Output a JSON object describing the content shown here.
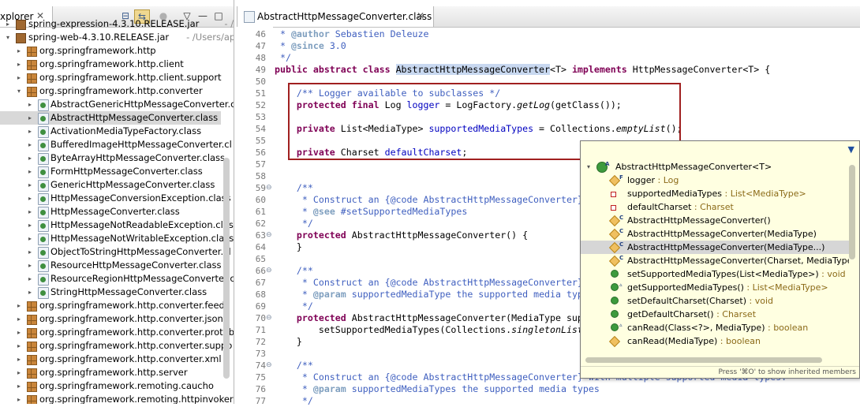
{
  "explorer": {
    "tab_label": "xplorer",
    "close_glyph": "✕",
    "toolbar": {
      "collapse_icon": "collapse-all-icon",
      "link_icon": "link-with-editor-icon",
      "view_menu_glyph": "▽",
      "minimize_glyph": "—",
      "maximize_glyph": "□"
    },
    "rows": [
      {
        "label": "spring-expression-4.3.10.RELEASE.jar",
        "suffix": " - /Users/",
        "type": "jar",
        "twisty": "▸",
        "indent": 0
      },
      {
        "label": "spring-web-4.3.10.RELEASE.jar",
        "suffix": " - /Users/appl",
        "type": "jar",
        "twisty": "▾",
        "indent": 0
      },
      {
        "label": "org.springframework.http",
        "suffix": "",
        "type": "pkg",
        "twisty": "▸",
        "indent": 1
      },
      {
        "label": "org.springframework.http.client",
        "suffix": "",
        "type": "pkg",
        "twisty": "▸",
        "indent": 1
      },
      {
        "label": "org.springframework.http.client.support",
        "suffix": "",
        "type": "pkg",
        "twisty": "▸",
        "indent": 1
      },
      {
        "label": "org.springframework.http.converter",
        "suffix": "",
        "type": "pkg",
        "twisty": "▾",
        "indent": 1
      },
      {
        "label": "AbstractGenericHttpMessageConverter.c",
        "suffix": "",
        "type": "cls",
        "twisty": "▸",
        "indent": 2
      },
      {
        "label": "AbstractHttpMessageConverter.class",
        "suffix": "",
        "type": "cls",
        "twisty": "▸",
        "indent": 2,
        "selected": true
      },
      {
        "label": "ActivationMediaTypeFactory.class",
        "suffix": "",
        "type": "cls",
        "twisty": "▸",
        "indent": 2
      },
      {
        "label": "BufferedImageHttpMessageConverter.cl",
        "suffix": "",
        "type": "cls",
        "twisty": "▸",
        "indent": 2
      },
      {
        "label": "ByteArrayHttpMessageConverter.class",
        "suffix": "",
        "type": "cls",
        "twisty": "▸",
        "indent": 2
      },
      {
        "label": "FormHttpMessageConverter.class",
        "suffix": "",
        "type": "cls",
        "twisty": "▸",
        "indent": 2
      },
      {
        "label": "GenericHttpMessageConverter.class",
        "suffix": "",
        "type": "cls",
        "twisty": "▸",
        "indent": 2
      },
      {
        "label": "HttpMessageConversionException.class",
        "suffix": "",
        "type": "cls",
        "twisty": "▸",
        "indent": 2
      },
      {
        "label": "HttpMessageConverter.class",
        "suffix": "",
        "type": "cls",
        "twisty": "▸",
        "indent": 2
      },
      {
        "label": "HttpMessageNotReadableException.clas",
        "suffix": "",
        "type": "cls",
        "twisty": "▸",
        "indent": 2
      },
      {
        "label": "HttpMessageNotWritableException.class",
        "suffix": "",
        "type": "cls",
        "twisty": "▸",
        "indent": 2
      },
      {
        "label": "ObjectToStringHttpMessageConverter.cl",
        "suffix": "",
        "type": "cls",
        "twisty": "▸",
        "indent": 2
      },
      {
        "label": "ResourceHttpMessageConverter.class",
        "suffix": "",
        "type": "cls",
        "twisty": "▸",
        "indent": 2
      },
      {
        "label": "ResourceRegionHttpMessageConverter.c",
        "suffix": "",
        "type": "cls",
        "twisty": "▸",
        "indent": 2
      },
      {
        "label": "StringHttpMessageConverter.class",
        "suffix": "",
        "type": "cls",
        "twisty": "▸",
        "indent": 2
      },
      {
        "label": "org.springframework.http.converter.feed",
        "suffix": "",
        "type": "pkg",
        "twisty": "▸",
        "indent": 1
      },
      {
        "label": "org.springframework.http.converter.json",
        "suffix": "",
        "type": "pkg",
        "twisty": "▸",
        "indent": 1
      },
      {
        "label": "org.springframework.http.converter.protob",
        "suffix": "",
        "type": "pkg",
        "twisty": "▸",
        "indent": 1
      },
      {
        "label": "org.springframework.http.converter.suppo",
        "suffix": "",
        "type": "pkg",
        "twisty": "▸",
        "indent": 1
      },
      {
        "label": "org.springframework.http.converter.xml",
        "suffix": "",
        "type": "pkg",
        "twisty": "▸",
        "indent": 1
      },
      {
        "label": "org.springframework.http.server",
        "suffix": "",
        "type": "pkg",
        "twisty": "▸",
        "indent": 1
      },
      {
        "label": "org.springframework.remoting.caucho",
        "suffix": "",
        "type": "pkg",
        "twisty": "▸",
        "indent": 1
      },
      {
        "label": "org.springframework.remoting.httpinvoker",
        "suffix": "",
        "type": "pkg",
        "twisty": "▸",
        "indent": 1
      }
    ]
  },
  "editor": {
    "tab_label": "AbstractHttpMessageConverter.class",
    "close_glyph": "✕",
    "lines": [
      {
        "n": "46",
        "fold": "",
        "parts": [
          {
            "t": " * ",
            "c": "cm"
          },
          {
            "t": "@author",
            "c": "tag"
          },
          {
            "t": " Sebastien Deleuze",
            "c": "cm"
          }
        ]
      },
      {
        "n": "47",
        "fold": "",
        "parts": [
          {
            "t": " * ",
            "c": "cm"
          },
          {
            "t": "@since",
            "c": "tag"
          },
          {
            "t": " 3.0",
            "c": "cm"
          }
        ]
      },
      {
        "n": "48",
        "fold": "",
        "parts": [
          {
            "t": " */",
            "c": "cm"
          }
        ]
      },
      {
        "n": "49",
        "fold": "",
        "parts": [
          {
            "t": "public abstract class ",
            "c": "kw"
          },
          {
            "t": "AbstractHttpMessageConverter",
            "c": "hl"
          },
          {
            "t": "<T> ",
            "c": ""
          },
          {
            "t": "implements ",
            "c": "kw"
          },
          {
            "t": "HttpMessageConverter<T> {",
            "c": ""
          }
        ]
      },
      {
        "n": "50",
        "fold": "",
        "parts": []
      },
      {
        "n": "51",
        "fold": "",
        "parts": [
          {
            "t": "    /** Logger available to subclasses */",
            "c": "cm"
          }
        ]
      },
      {
        "n": "52",
        "fold": "",
        "parts": [
          {
            "t": "    protected final ",
            "c": "kw"
          },
          {
            "t": "Log ",
            "c": ""
          },
          {
            "t": "logger",
            "c": "fd"
          },
          {
            "t": " = LogFactory.",
            "c": ""
          },
          {
            "t": "getLog",
            "c": "it"
          },
          {
            "t": "(getClass());",
            "c": ""
          }
        ]
      },
      {
        "n": "53",
        "fold": "",
        "parts": []
      },
      {
        "n": "54",
        "fold": "",
        "parts": [
          {
            "t": "    private ",
            "c": "kw"
          },
          {
            "t": "List<MediaType> ",
            "c": ""
          },
          {
            "t": "supportedMediaTypes",
            "c": "fd"
          },
          {
            "t": " = Collections.",
            "c": ""
          },
          {
            "t": "emptyList",
            "c": "it"
          },
          {
            "t": "();",
            "c": ""
          }
        ]
      },
      {
        "n": "55",
        "fold": "",
        "parts": []
      },
      {
        "n": "56",
        "fold": "",
        "parts": [
          {
            "t": "    private ",
            "c": "kw"
          },
          {
            "t": "Charset ",
            "c": ""
          },
          {
            "t": "defaultCharset",
            "c": "fd"
          },
          {
            "t": ";",
            "c": ""
          }
        ]
      },
      {
        "n": "57",
        "fold": "",
        "parts": []
      },
      {
        "n": "58",
        "fold": "",
        "parts": []
      },
      {
        "n": "59",
        "fold": "⊖",
        "parts": [
          {
            "t": "    /**",
            "c": "cm"
          }
        ]
      },
      {
        "n": "60",
        "fold": "",
        "parts": [
          {
            "t": "     * Construct an {@code AbstractHttpMessageConverter}",
            "c": "cm"
          }
        ]
      },
      {
        "n": "61",
        "fold": "",
        "parts": [
          {
            "t": "     * ",
            "c": "cm"
          },
          {
            "t": "@see",
            "c": "tag"
          },
          {
            "t": " #setSupportedMediaTypes",
            "c": "cm"
          }
        ]
      },
      {
        "n": "62",
        "fold": "",
        "parts": [
          {
            "t": "     */",
            "c": "cm"
          }
        ]
      },
      {
        "n": "63",
        "fold": "⊖",
        "parts": [
          {
            "t": "    protected ",
            "c": "kw"
          },
          {
            "t": "AbstractHttpMessageConverter() {",
            "c": ""
          }
        ]
      },
      {
        "n": "64",
        "fold": "",
        "parts": [
          {
            "t": "    }",
            "c": ""
          }
        ]
      },
      {
        "n": "65",
        "fold": "",
        "parts": []
      },
      {
        "n": "66",
        "fold": "⊖",
        "parts": [
          {
            "t": "    /**",
            "c": "cm"
          }
        ]
      },
      {
        "n": "67",
        "fold": "",
        "parts": [
          {
            "t": "     * Construct an {@code AbstractHttpMessageConverter}",
            "c": "cm"
          }
        ]
      },
      {
        "n": "68",
        "fold": "",
        "parts": [
          {
            "t": "     * ",
            "c": "cm"
          },
          {
            "t": "@param",
            "c": "tag"
          },
          {
            "t": " supportedMediaType the supported media typ",
            "c": "cm"
          }
        ]
      },
      {
        "n": "69",
        "fold": "",
        "parts": [
          {
            "t": "     */",
            "c": "cm"
          }
        ]
      },
      {
        "n": "70",
        "fold": "⊖",
        "parts": [
          {
            "t": "    protected ",
            "c": "kw"
          },
          {
            "t": "AbstractHttpMessageConverter(MediaType sup",
            "c": ""
          }
        ]
      },
      {
        "n": "71",
        "fold": "",
        "parts": [
          {
            "t": "        setSupportedMediaTypes(Collections.",
            "c": ""
          },
          {
            "t": "singletonList",
            "c": "it"
          }
        ]
      },
      {
        "n": "72",
        "fold": "",
        "parts": [
          {
            "t": "    }",
            "c": ""
          }
        ]
      },
      {
        "n": "73",
        "fold": "",
        "parts": []
      },
      {
        "n": "74",
        "fold": "⊖",
        "parts": [
          {
            "t": "    /**",
            "c": "cm"
          }
        ]
      },
      {
        "n": "75",
        "fold": "",
        "parts": [
          {
            "t": "     * Construct an {@code AbstractHttpMessageConverter} with multiple supported media types.",
            "c": "cm"
          }
        ]
      },
      {
        "n": "76",
        "fold": "",
        "parts": [
          {
            "t": "     * ",
            "c": "cm"
          },
          {
            "t": "@param",
            "c": "tag"
          },
          {
            "t": " supportedMediaTypes the supported media types",
            "c": "cm"
          }
        ]
      },
      {
        "n": "77",
        "fold": "",
        "parts": [
          {
            "t": "     */",
            "c": "cm"
          }
        ]
      }
    ]
  },
  "outline": {
    "menu_glyph": "▼",
    "items": [
      {
        "name": "AbstractHttpMessageConverter<T>",
        "type": "",
        "icon": "cls",
        "sup": "A",
        "twisty": "▾",
        "indent": 0
      },
      {
        "name": "logger",
        "type": " : Log",
        "icon": "diamond",
        "sup": "F",
        "indent": 1
      },
      {
        "name": "supportedMediaTypes",
        "type": " : List<MediaType>",
        "icon": "sqred",
        "sup": "",
        "indent": 1
      },
      {
        "name": "defaultCharset",
        "type": " : Charset",
        "icon": "sqred",
        "sup": "",
        "indent": 1
      },
      {
        "name": "AbstractHttpMessageConverter()",
        "type": "",
        "icon": "diamond",
        "sup": "C",
        "indent": 1
      },
      {
        "name": "AbstractHttpMessageConverter(MediaType)",
        "type": "",
        "icon": "diamond",
        "sup": "C",
        "indent": 1
      },
      {
        "name": "AbstractHttpMessageConverter(MediaType...)",
        "type": "",
        "icon": "diamond",
        "sup": "C",
        "indent": 1,
        "selected": true
      },
      {
        "name": "AbstractHttpMessageConverter(Charset, MediaType",
        "type": "",
        "icon": "diamond",
        "sup": "C",
        "indent": 1
      },
      {
        "name": "setSupportedMediaTypes(List<MediaType>)",
        "type": " : void",
        "icon": "green",
        "sup": "",
        "indent": 1
      },
      {
        "name": "getSupportedMediaTypes()",
        "type": " : List<MediaType>",
        "icon": "green",
        "sup": "▵",
        "indent": 1
      },
      {
        "name": "setDefaultCharset(Charset)",
        "type": " : void",
        "icon": "green",
        "sup": "",
        "indent": 1
      },
      {
        "name": "getDefaultCharset()",
        "type": " : Charset",
        "icon": "green",
        "sup": "",
        "indent": 1
      },
      {
        "name": "canRead(Class<?>, MediaType)",
        "type": " : boolean",
        "icon": "green",
        "sup": "▵",
        "indent": 1
      },
      {
        "name": "canRead(MediaType)",
        "type": " : boolean",
        "icon": "diamond",
        "sup": "",
        "indent": 1
      }
    ],
    "footer": "Press '⌘O' to show inherited members"
  },
  "colors": {
    "keyword": "#7f0055",
    "comment": "#3f5fbf",
    "field": "#0000c0",
    "highlight_box": "#a02020",
    "popup_bg": "#ffffe1"
  }
}
